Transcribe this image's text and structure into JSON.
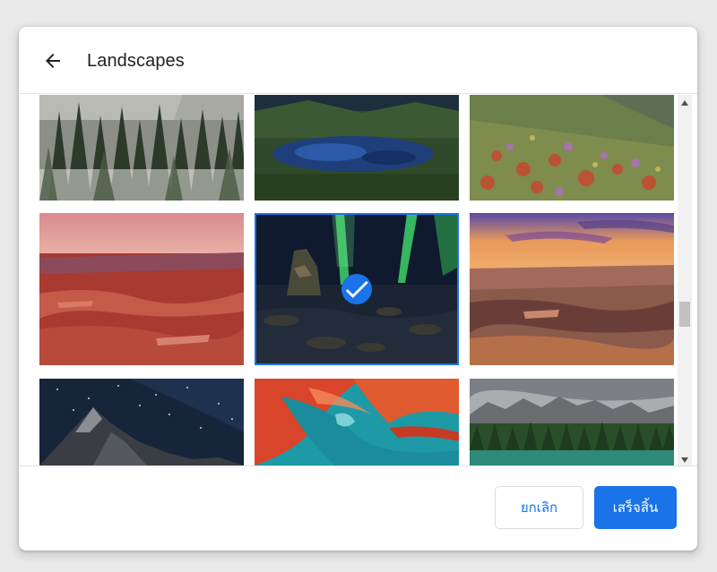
{
  "dialog": {
    "title": "Landscapes",
    "back_icon": "arrow-left-icon"
  },
  "wallpapers": [
    {
      "name": "snowy-pine-forest",
      "selected": false
    },
    {
      "name": "mountain-lake",
      "selected": false
    },
    {
      "name": "wildflower-meadow",
      "selected": false
    },
    {
      "name": "red-canyon-dusk",
      "selected": false
    },
    {
      "name": "aurora-over-rocks",
      "selected": true
    },
    {
      "name": "grand-canyon-sunset",
      "selected": false
    },
    {
      "name": "starry-mountain-peak",
      "selected": false
    },
    {
      "name": "antelope-canyon",
      "selected": false
    },
    {
      "name": "alpine-lake-forest",
      "selected": false
    }
  ],
  "selected_icon": "checkmark-icon",
  "footer": {
    "cancel_label": "ยกเลิก",
    "done_label": "เสร็จสิ้น"
  },
  "colors": {
    "accent": "#1a73e8"
  }
}
